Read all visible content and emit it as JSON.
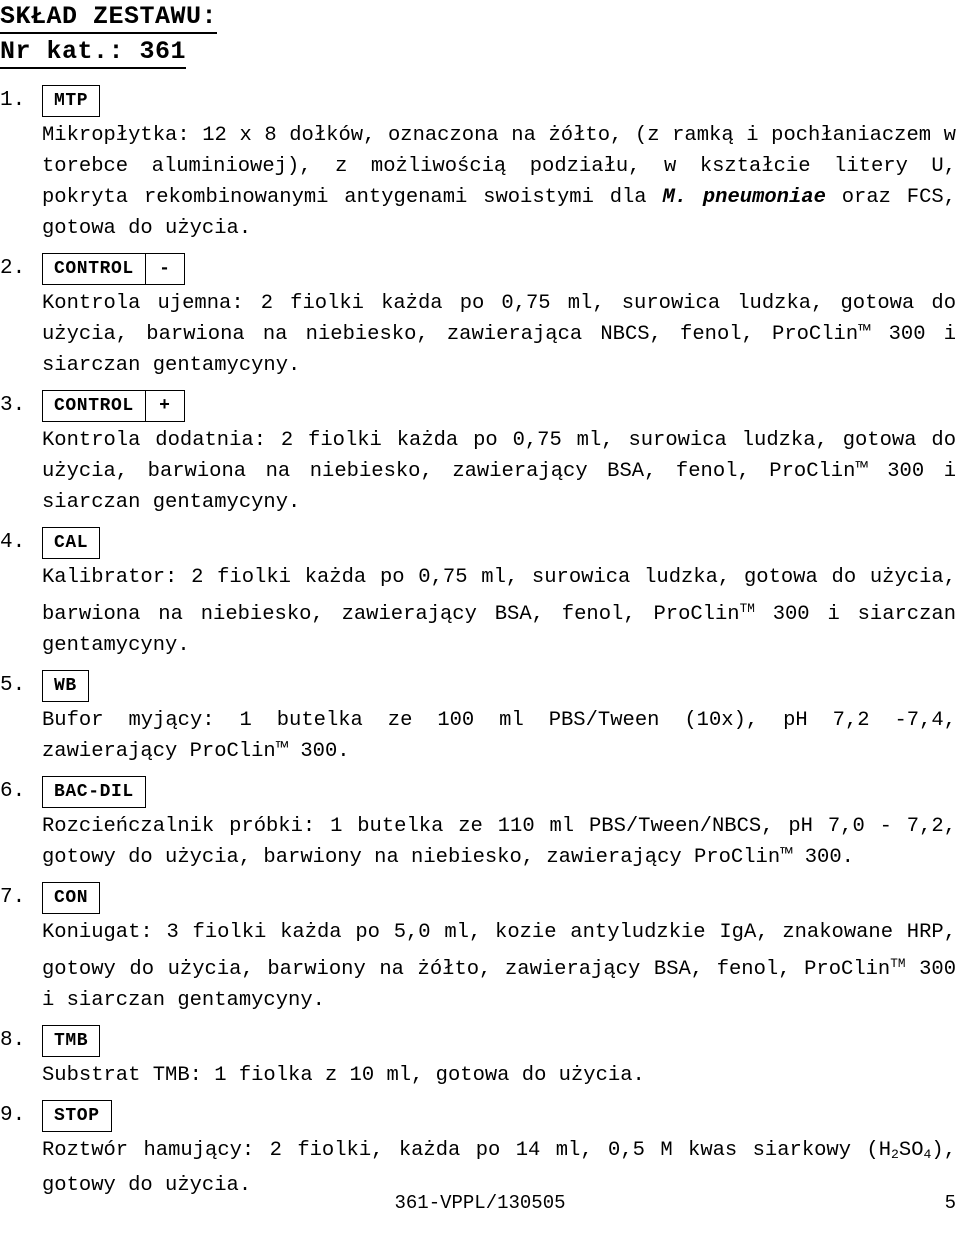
{
  "document": {
    "heading_1": "SKŁAD ZESTAWU:",
    "heading_2": "Nr kat.: 361"
  },
  "items": [
    {
      "number": "1.",
      "tag": "MTP",
      "tag_sign": "",
      "body_pre": "Mikropłytka: 12 x 8 dołków, oznaczona na żółto, (z ramką i pochłaniaczem w torebce aluminiowej), z możliwością podziału, w kształcie litery U, pokryta rekombinowanymi antygenami swoistymi dla ",
      "body_em": "M. pneumoniae",
      "body_post": " oraz FCS, gotowa do użycia."
    },
    {
      "number": "2.",
      "tag": "CONTROL",
      "tag_sign": "-",
      "body_pre": "Kontrola ujemna: 2 fiolki każda po 0,75 ml, surowica ludzka, gotowa do użycia, barwiona na niebiesko, zawierająca NBCS, fenol, ProClin™ 300 i siarczan gentamycyny.",
      "body_em": "",
      "body_post": ""
    },
    {
      "number": "3.",
      "tag": "CONTROL",
      "tag_sign": "+",
      "body_pre": "Kontrola dodatnia: 2 fiolki każda po 0,75 ml, surowica ludzka, gotowa do użycia, barwiona na niebiesko, zawierający BSA, fenol, ProClin™ 300 i siarczan gentamycyny.",
      "body_em": "",
      "body_post": ""
    },
    {
      "number": "4.",
      "tag": "CAL",
      "tag_sign": "",
      "body_pre": "Kalibrator: 2 fiolki każda po 0,75 ml, surowica ludzka, gotowa do użycia, barwiona na niebiesko, zawierający BSA, fenol, ProClin",
      "body_sup": "TM",
      "body_post": " 300 i siarczan gentamycyny."
    },
    {
      "number": "5.",
      "tag": "WB",
      "tag_sign": "",
      "body_pre": "Bufor myjący: 1 butelka ze 100 ml PBS/Tween (10x), pH 7,2 -7,4, zawierający ProClin™ 300.",
      "body_em": "",
      "body_post": ""
    },
    {
      "number": "6.",
      "tag": "BAC-DIL",
      "tag_sign": "",
      "body_pre": "Rozcieńczalnik próbki: 1 butelka ze 110 ml PBS/Tween/NBCS, pH 7,0 - 7,2, gotowy do użycia, barwiony na niebiesko, zawierający ProClin™ 300.",
      "body_em": "",
      "body_post": ""
    },
    {
      "number": "7.",
      "tag": "CON",
      "tag_sign": "",
      "body_pre": "Koniugat: 3 fiolki każda po 5,0 ml, kozie antyludzkie IgA, znakowane HRP, gotowy do użycia, barwiony na żółto, zawierający BSA, fenol, ProClin",
      "body_sup": "TM",
      "body_post": " 300 i siarczan gentamycyny."
    },
    {
      "number": "8.",
      "tag": "TMB",
      "tag_sign": "",
      "body_pre": "Substrat TMB: 1 fiolka z 10 ml, gotowa do użycia.",
      "body_em": "",
      "body_post": ""
    },
    {
      "number": "9.",
      "tag": "STOP",
      "tag_sign": "",
      "body_pre": "Roztwór hamujący: 2 fiolki, każda po 14 ml, 0,5 M kwas siarkowy (H",
      "body_sub_1": "2",
      "body_mid_1": "SO",
      "body_sub_2": "4",
      "body_post": "), gotowy do użycia."
    }
  ],
  "footer": {
    "reference": "361-VPPL/130505",
    "page_number": "5"
  }
}
